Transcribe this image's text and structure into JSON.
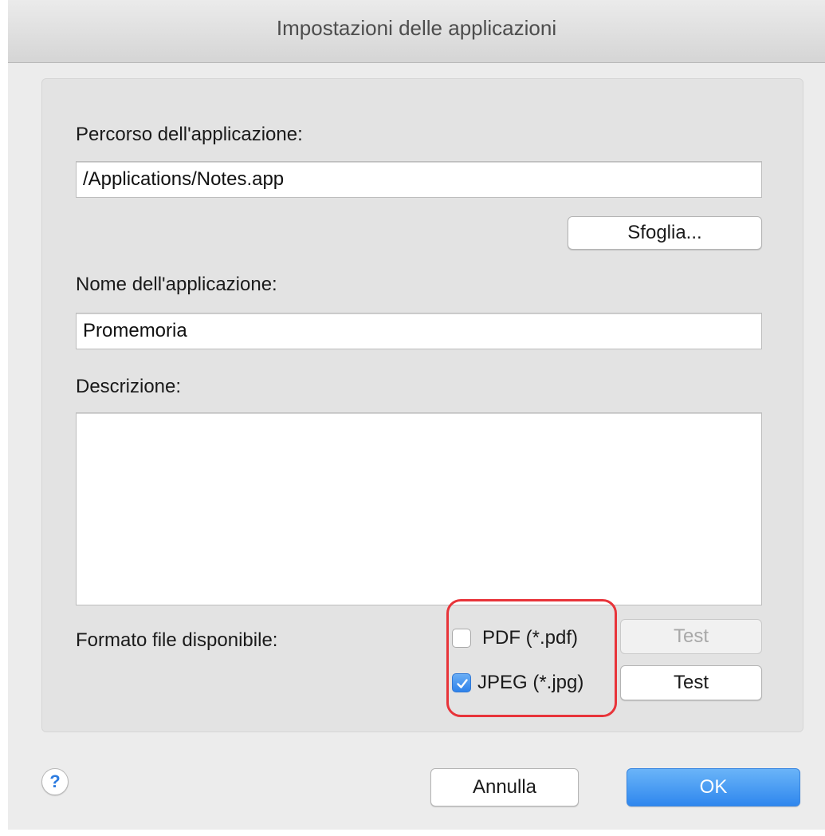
{
  "window": {
    "title": "Impostazioni delle applicazioni"
  },
  "form": {
    "path_label": "Percorso dell'applicazione:",
    "path_value": "/Applications/Notes.app",
    "browse_button": "Sfoglia...",
    "name_label": "Nome dell'applicazione:",
    "name_value": "Promemoria",
    "description_label": "Descrizione:",
    "description_value": "",
    "format_label": "Formato file disponibile:",
    "formats": [
      {
        "label": "PDF (*.pdf)",
        "checked": false,
        "test_label": "Test",
        "test_enabled": false
      },
      {
        "label": "JPEG (*.jpg)",
        "checked": true,
        "test_label": "Test",
        "test_enabled": true
      }
    ]
  },
  "footer": {
    "help_label": "?",
    "cancel_button": "Annulla",
    "ok_button": "OK"
  },
  "colors": {
    "accent": "#2f87ee",
    "highlight": "#e8343a"
  },
  "icons": {
    "check": "checkmark-icon",
    "help": "question-mark-icon"
  }
}
